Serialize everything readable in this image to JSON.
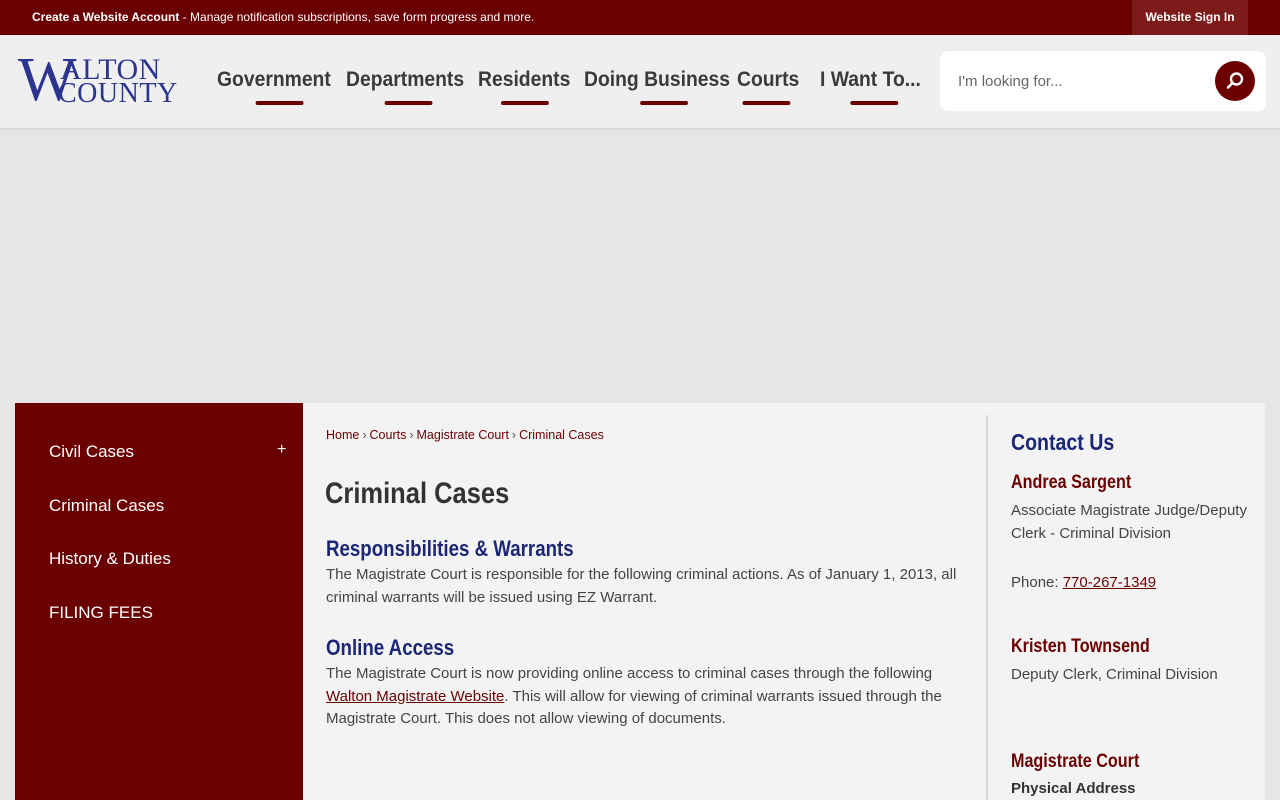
{
  "topbar": {
    "account_link": "Create a Website Account",
    "account_desc": " - Manage notification subscriptions, save form progress and more.",
    "signin": "Website Sign In"
  },
  "logo": {
    "w": "W",
    "line1": "ALTON",
    "line2": "COUNTY"
  },
  "nav": {
    "items": [
      "Government",
      "Departments",
      "Residents",
      "Doing Business",
      "Courts",
      "I Want To..."
    ]
  },
  "search": {
    "placeholder": "I'm looking for..."
  },
  "sidebar": {
    "items": [
      "Civil Cases",
      "Criminal Cases",
      "History & Duties",
      "FILING FEES"
    ],
    "expand": "+"
  },
  "breadcrumb": {
    "items": [
      "Home",
      "Courts",
      "Magistrate Court",
      "Criminal Cases"
    ],
    "sep": "›"
  },
  "main": {
    "title": "Criminal Cases",
    "section1": {
      "heading": "Responsibilities & Warrants",
      "text": "The Magistrate Court is responsible for the following criminal actions. As of January 1, 2013, all criminal warrants will be issued using EZ Warrant."
    },
    "section2": {
      "heading": "Online Access",
      "text_before": "The Magistrate Court is now providing online access to criminal cases through the following ",
      "link": "Walton Magistrate Website",
      "text_after": ". This will allow for viewing of criminal warrants issued through the Magistrate Court. This does not allow viewing of documents."
    }
  },
  "contact": {
    "title": "Contact Us",
    "person1": {
      "name": "Andrea Sargent",
      "role": "Associate Magistrate Judge/Deputy Clerk - Criminal Division",
      "phone_label": "Phone: ",
      "phone": "770-267-1349"
    },
    "person2": {
      "name": "Kristen Townsend",
      "role": "Deputy Clerk, Criminal Division"
    },
    "office": {
      "name": "Magistrate Court",
      "address_label": "Physical Address"
    }
  }
}
